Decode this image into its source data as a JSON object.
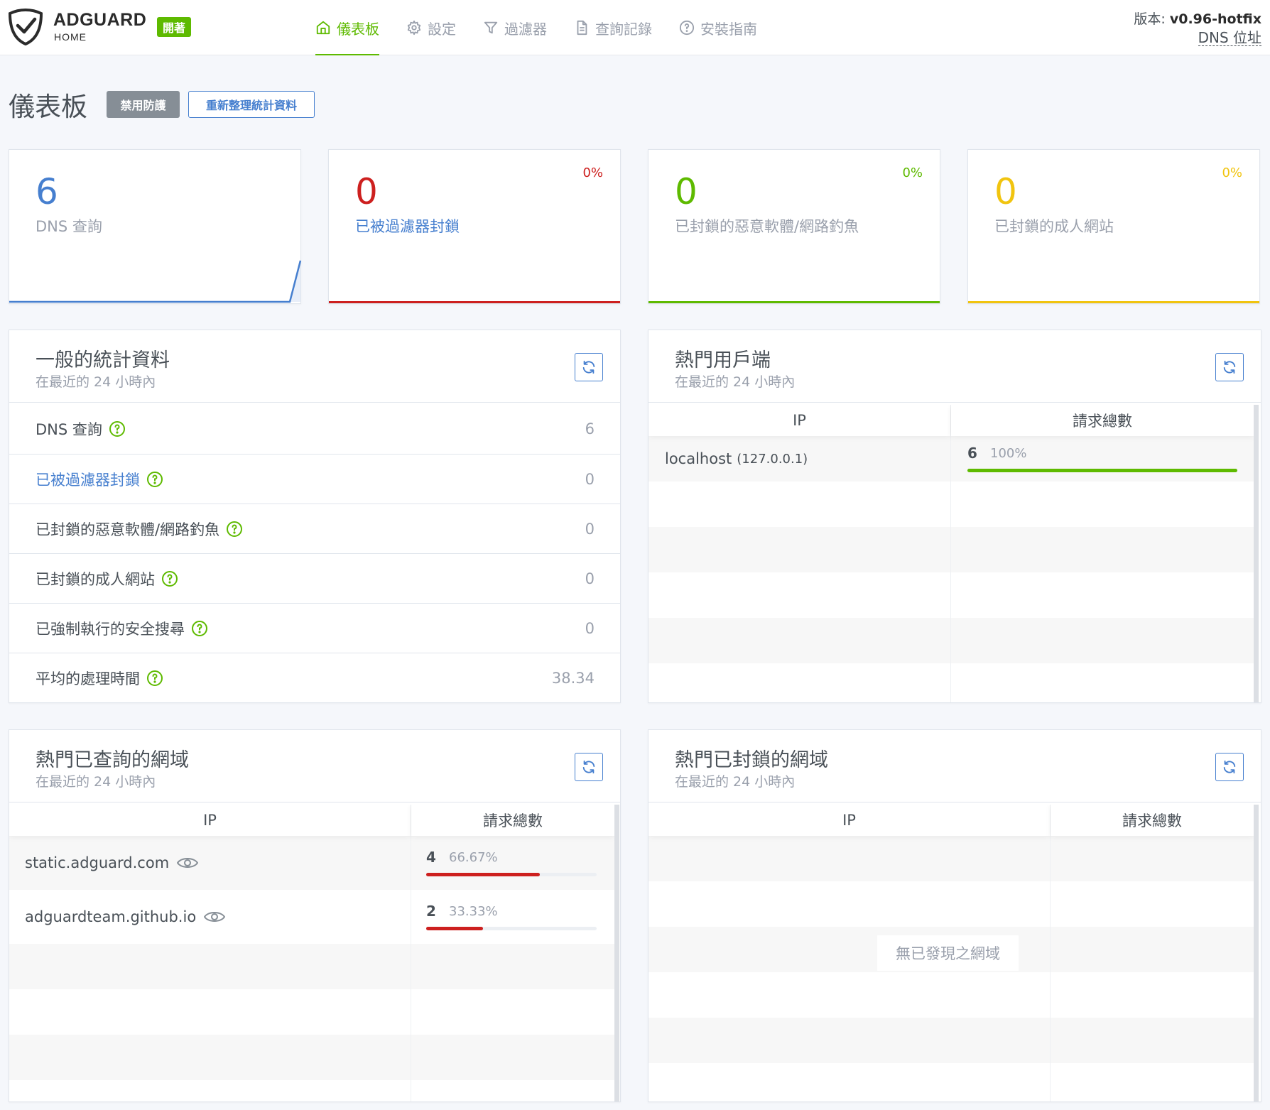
{
  "header": {
    "brand": "ADGUARD",
    "brand_sub": "HOME",
    "status_badge": "開著",
    "nav": [
      {
        "label": "儀表板",
        "icon": "home-icon",
        "active": true
      },
      {
        "label": "設定",
        "icon": "gear-icon",
        "active": false
      },
      {
        "label": "過濾器",
        "icon": "filter-icon",
        "active": false
      },
      {
        "label": "查詢記錄",
        "icon": "document-icon",
        "active": false
      },
      {
        "label": "安裝指南",
        "icon": "help-circle-icon",
        "active": false
      }
    ],
    "version_label": "版本:",
    "version_value": "v0.96-hotfix",
    "dns_link": "DNS 位址"
  },
  "page": {
    "title": "儀表板",
    "disable_button": "禁用防護",
    "refresh_button": "重新整理統計資料"
  },
  "stat_cards": [
    {
      "value": "6",
      "label": "DNS 查詢",
      "percent": "",
      "color": "#467fcf"
    },
    {
      "value": "0",
      "label": "已被過濾器封鎖",
      "percent": "0%",
      "color": "#cd201f"
    },
    {
      "value": "0",
      "label": "已封鎖的惡意軟體/網路釣魚",
      "percent": "0%",
      "color": "#5eba00"
    },
    {
      "value": "0",
      "label": "已封鎖的成人網站",
      "percent": "0%",
      "color": "#f1c40f"
    }
  ],
  "general_stats": {
    "title": "一般的統計資料",
    "subtitle": "在最近的 24 小時內",
    "rows": [
      {
        "label": "DNS 查詢",
        "value": "6"
      },
      {
        "label": "已被過濾器封鎖",
        "value": "0"
      },
      {
        "label": "已封鎖的惡意軟體/網路釣魚",
        "value": "0"
      },
      {
        "label": "已封鎖的成人網站",
        "value": "0"
      },
      {
        "label": "已強制執行的安全搜尋",
        "value": "0"
      },
      {
        "label": "平均的處理時間",
        "value": "38.34"
      }
    ]
  },
  "top_clients": {
    "title": "熱門用戶端",
    "subtitle": "在最近的 24 小時內",
    "columns": [
      "IP",
      "請求總數"
    ],
    "rows": [
      {
        "name": "localhost",
        "ip": "(127.0.0.1)",
        "count": "6",
        "percent": "100%",
        "ratio": 1.0
      }
    ]
  },
  "top_queried": {
    "title": "熱門已查詢的網域",
    "subtitle": "在最近的 24 小時內",
    "columns": [
      "IP",
      "請求總數"
    ],
    "rows": [
      {
        "domain": "static.adguard.com",
        "count": "4",
        "percent": "66.67%",
        "ratio": 0.6667
      },
      {
        "domain": "adguardteam.github.io",
        "count": "2",
        "percent": "33.33%",
        "ratio": 0.3333
      }
    ]
  },
  "top_blocked": {
    "title": "熱門已封鎖的網域",
    "subtitle": "在最近的 24 小時內",
    "columns": [
      "IP",
      "請求總數"
    ],
    "empty_message": "無已發現之網域"
  },
  "colors": {
    "green": "#5eba00",
    "blue": "#467fcf",
    "red": "#cd201f",
    "yellow": "#f1c40f"
  }
}
